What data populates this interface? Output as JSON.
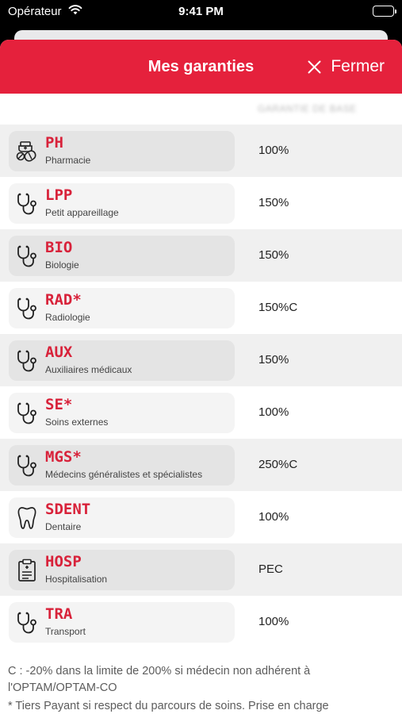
{
  "status_bar": {
    "carrier": "Opérateur",
    "time": "9:41 PM"
  },
  "header": {
    "title": "Mes garanties",
    "close_label": "Fermer",
    "background": "#e5213c"
  },
  "table": {
    "column_header": "GARANTIE DE BASE",
    "rows": [
      {
        "code": "PH",
        "label": "Pharmacie",
        "rate": "100%",
        "icon": "pharmacy-icon"
      },
      {
        "code": "LPP",
        "label": "Petit appareillage",
        "rate": "150%",
        "icon": "stethoscope-icon"
      },
      {
        "code": "BIO",
        "label": "Biologie",
        "rate": "150%",
        "icon": "stethoscope-icon"
      },
      {
        "code": "RAD*",
        "label": "Radiologie",
        "rate": "150%C",
        "icon": "stethoscope-icon"
      },
      {
        "code": "AUX",
        "label": "Auxiliaires médicaux",
        "rate": "150%",
        "icon": "stethoscope-icon"
      },
      {
        "code": "SE*",
        "label": "Soins externes",
        "rate": "100%",
        "icon": "stethoscope-icon"
      },
      {
        "code": "MGS*",
        "label": "Médecins généralistes et spécialistes",
        "rate": "250%C",
        "icon": "stethoscope-icon"
      },
      {
        "code": "SDENT",
        "label": "Dentaire",
        "rate": "100%",
        "icon": "tooth-icon"
      },
      {
        "code": "HOSP",
        "label": "Hospitalisation",
        "rate": "PEC",
        "icon": "clipboard-icon"
      },
      {
        "code": "TRA",
        "label": "Transport",
        "rate": "100%",
        "icon": "stethoscope-icon"
      }
    ]
  },
  "footnotes": {
    "note_c": "C : -20% dans la limite de 200% si médecin non adhérent à l'OPTAM/OPTAM-CO",
    "note_star": "* Tiers Payant si respect du parcours de soins. Prise en charge"
  },
  "colors": {
    "accent": "#e5213c",
    "code_text": "#d8223a"
  }
}
